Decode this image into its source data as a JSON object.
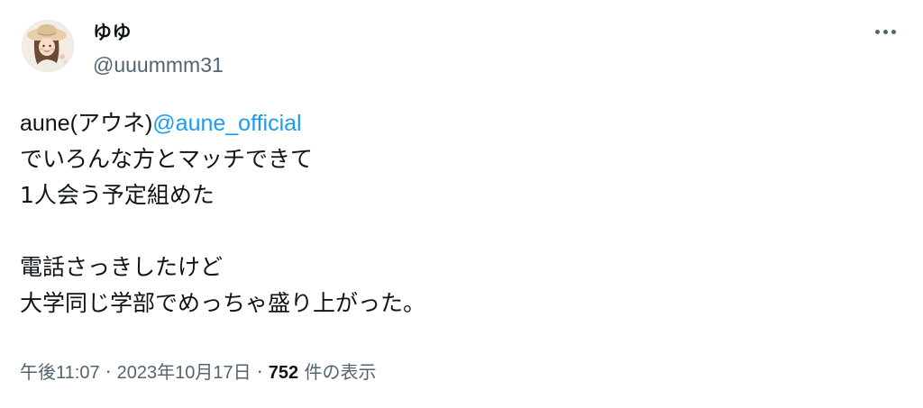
{
  "user": {
    "display_name": "ゆゆ",
    "handle": "@uuummm31",
    "avatar_icon": "avatar-illustration-girl-straw-hat"
  },
  "menu": {
    "icon": "more-horizontal-icon"
  },
  "tweet": {
    "prefix": "aune(アウネ)",
    "mention": "@aune_official",
    "lines": [
      "でいろんな方とマッチできて",
      "1人会う予定組めた",
      "",
      "電話さっきしたけど",
      "大学同じ学部でめっちゃ盛り上がった。"
    ]
  },
  "meta": {
    "time": "午後11:07",
    "separator": "·",
    "date": "2023年10月17日",
    "views_count": "752",
    "views_label": "件の表示"
  },
  "colors": {
    "link": "#1d9bf0",
    "secondary_text": "#536471",
    "primary_text": "#0f1419",
    "background": "#ffffff"
  }
}
